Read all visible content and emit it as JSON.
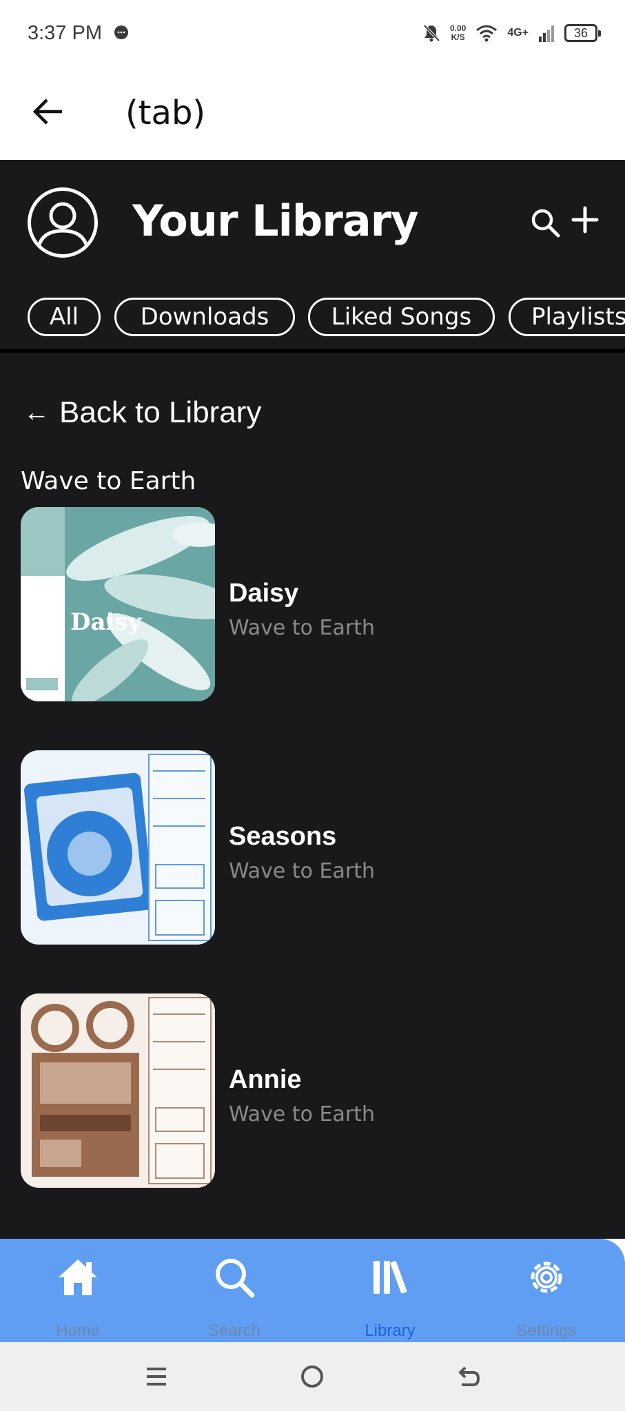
{
  "status_bar": {
    "time": "3:37 PM",
    "net_speed_value": "0.00",
    "net_speed_unit": "K/S",
    "network": "4G+",
    "battery": "36"
  },
  "app_bar": {
    "title": "(tab)"
  },
  "library": {
    "title": "Your Library",
    "filters": [
      "All",
      "Downloads",
      "Liked Songs",
      "Playlists"
    ],
    "back_label": "Back to Library",
    "back_arrow": "←",
    "artist": "Wave to Earth",
    "albums": [
      {
        "title": "Daisy",
        "artist": "Wave to Earth",
        "cover_text": "Daisy",
        "cover_colors": [
          "#6aa6a3",
          "#dfeeee"
        ]
      },
      {
        "title": "Seasons",
        "artist": "Wave to Earth",
        "cover_colors": [
          "#2f7fd6",
          "#eef4fb"
        ]
      },
      {
        "title": "Annie",
        "artist": "Wave to Earth",
        "cover_colors": [
          "#9a6a4e",
          "#f6efe9"
        ]
      }
    ]
  },
  "bottom_nav": {
    "items": [
      {
        "label": "Home",
        "icon": "home-icon"
      },
      {
        "label": "Search",
        "icon": "search-icon"
      },
      {
        "label": "Library",
        "icon": "library-icon",
        "active": true
      },
      {
        "label": "Settings",
        "icon": "gear-icon"
      }
    ]
  },
  "colors": {
    "background_dark": "#19191b",
    "nav_blue": "#5f9ef2",
    "active_label": "#1c63d8"
  }
}
